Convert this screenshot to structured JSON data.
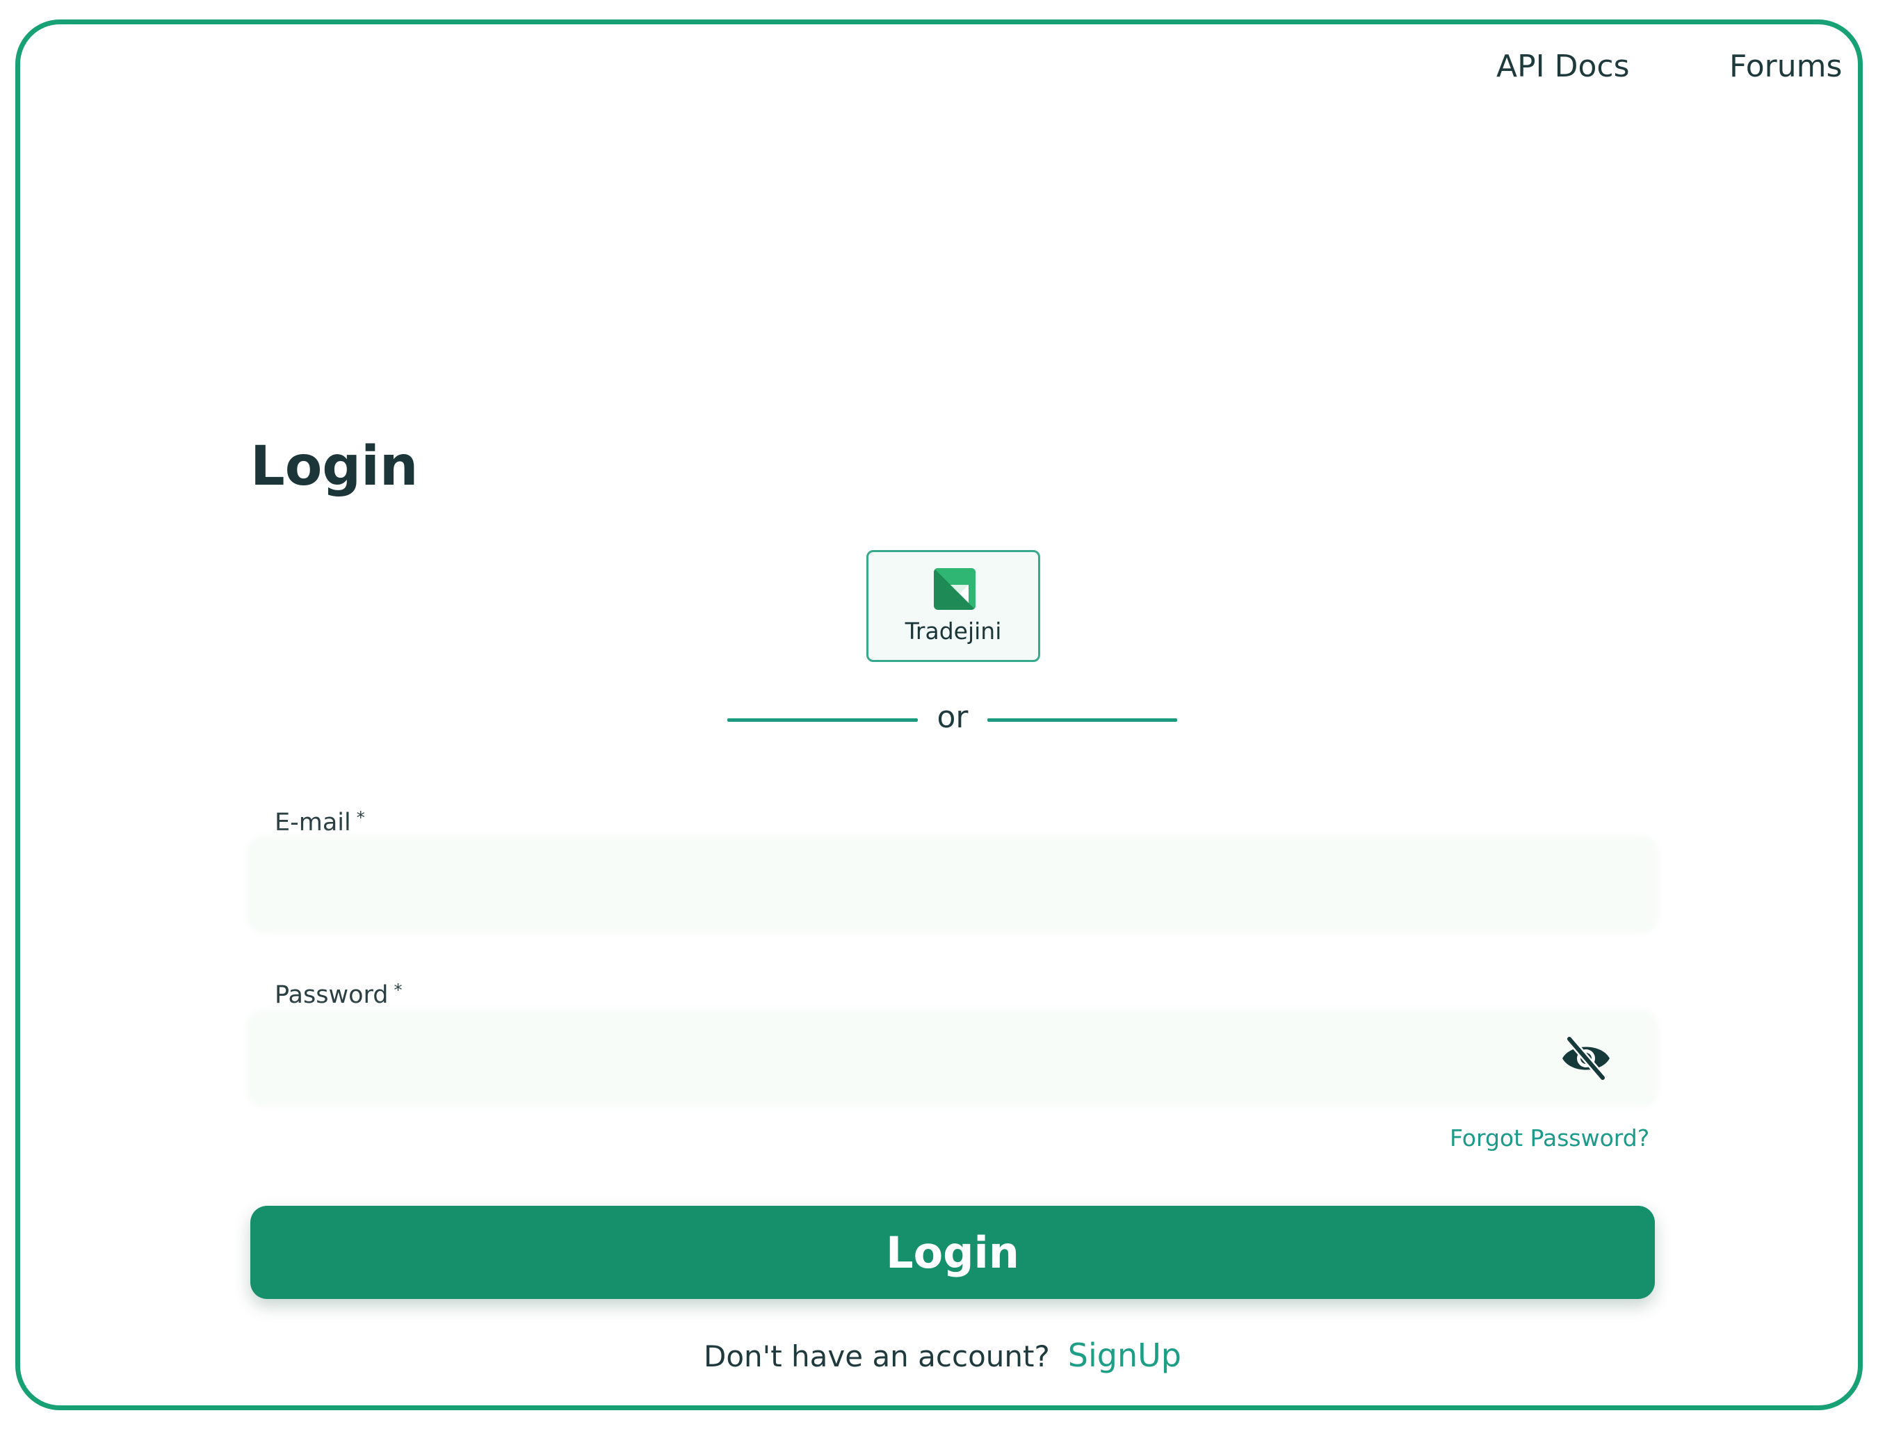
{
  "nav": {
    "api_docs": "API Docs",
    "forums": "Forums"
  },
  "login": {
    "title": "Login",
    "provider_label": "Tradejini",
    "divider_text": "or",
    "email_label": "E-mail",
    "email_value": "",
    "password_label": "Password",
    "password_value": "",
    "required_mark": "*",
    "forgot_password": "Forgot Password?",
    "submit_label": "Login",
    "signup_prompt": "Don't have an account?",
    "signup_link": "SignUp"
  },
  "icons": {
    "provider_logo": "tradejini-logo-icon",
    "password_toggle": "eye-slash-icon"
  },
  "colors": {
    "accent": "#168f6b",
    "frame_border": "#17a174",
    "link": "#1c9a8a",
    "text_dark": "#1c3538"
  }
}
